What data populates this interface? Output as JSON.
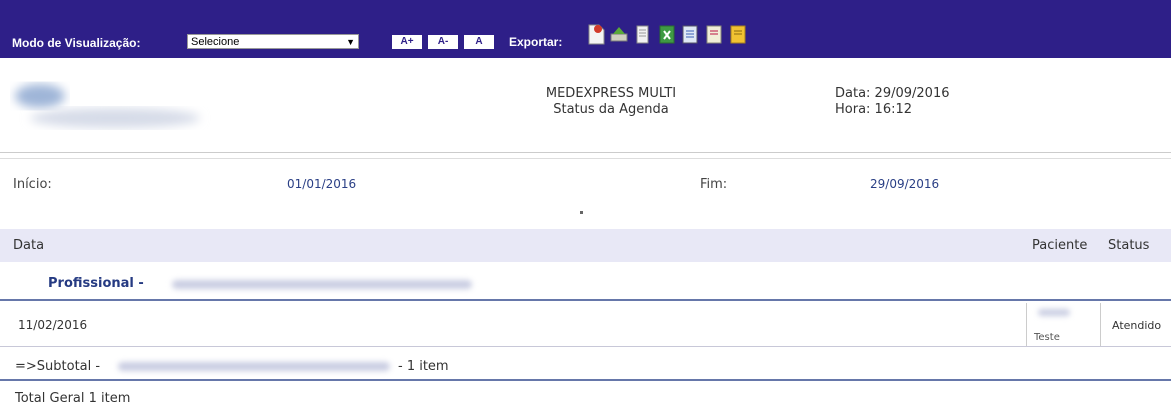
{
  "toolbar": {
    "mode_label": "Modo de Visualização:",
    "mode_select_value": "Selecione",
    "font_buttons": [
      "A+",
      "A-",
      "A"
    ],
    "export_label": "Exportar:",
    "export_icons": [
      "page-icon",
      "printer-icon",
      "document-icon",
      "excel-icon",
      "word-icon",
      "pdf-icon",
      "note-icon"
    ],
    "background_color": "#2e1f88"
  },
  "header": {
    "title": "MEDEXPRESS MULTI",
    "subtitle": "Status da Agenda",
    "date": "Data: 29/09/2016",
    "time": "Hora: 16:12"
  },
  "filters": {
    "start_label": "Início:",
    "start_value": "01/01/2016",
    "end_label": "Fim:",
    "end_value": "29/09/2016"
  },
  "table": {
    "headers": [
      "Data",
      "Paciente",
      "Status"
    ],
    "group_title": "Profissional -",
    "rows": [
      {
        "date": "11/02/2016",
        "paciente": "Teste",
        "status": "Atendido"
      }
    ],
    "subtotal_label": "=>Subtotal -",
    "subtotal_count": "- 1 item",
    "total": "Total Geral 1 item"
  }
}
